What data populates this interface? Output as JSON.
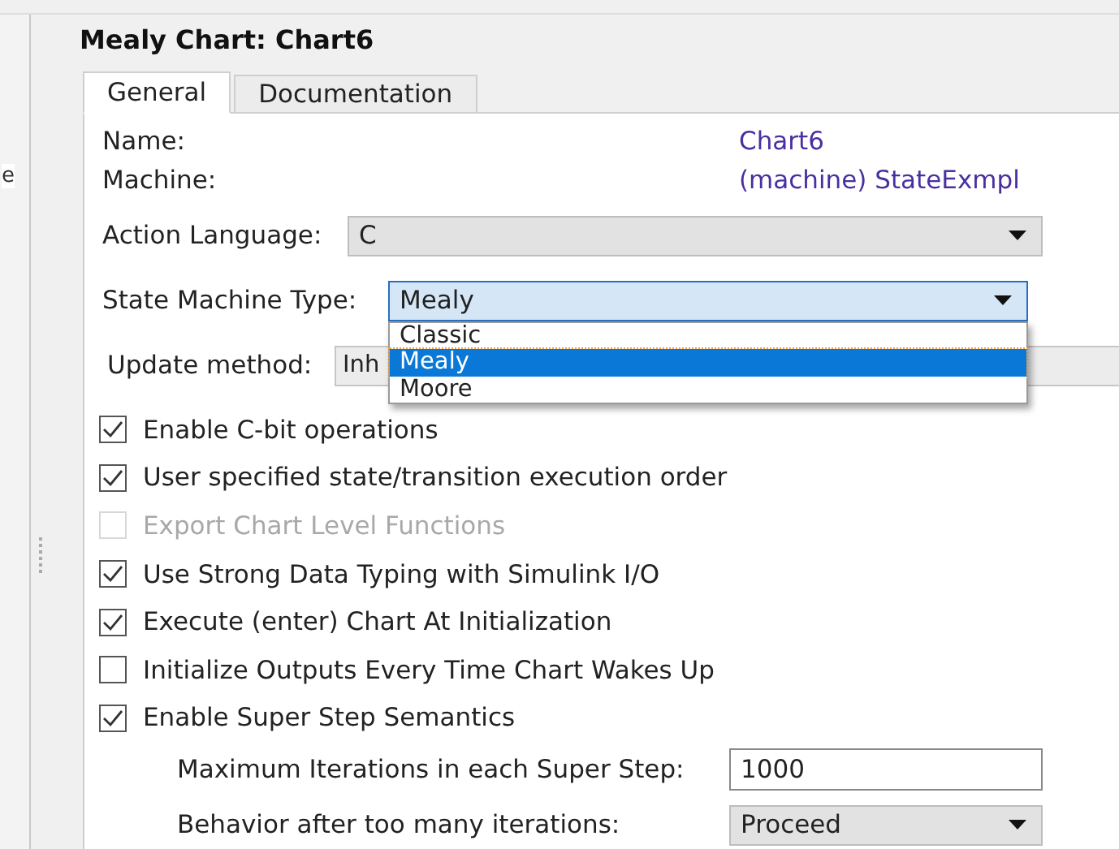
{
  "title": "Mealy Chart: Chart6",
  "left_pane": {
    "text": "e"
  },
  "tabs": [
    {
      "label": "General",
      "selected": true
    },
    {
      "label": "Documentation",
      "selected": false
    }
  ],
  "info": [
    {
      "label": "Name:",
      "value": "Chart6"
    },
    {
      "label": "Machine:",
      "value": "(machine) StateExmpl"
    }
  ],
  "action_language": {
    "label": "Action Language:",
    "value": "C"
  },
  "state_machine_type": {
    "label": "State Machine Type:",
    "value": "Mealy",
    "expanded": true,
    "options": [
      {
        "label": "Classic",
        "selected": false
      },
      {
        "label": "Mealy",
        "selected": true
      },
      {
        "label": "Moore",
        "selected": false
      }
    ]
  },
  "update_method": {
    "label": "Update method:",
    "value": "Inh"
  },
  "options": [
    {
      "label": "Enable C-bit operations",
      "checked": true,
      "disabled": false
    },
    {
      "label": "User specified state/transition execution order",
      "checked": true,
      "disabled": false
    },
    {
      "label": "Export Chart Level Functions",
      "checked": false,
      "disabled": true
    },
    {
      "label": "Use Strong Data Typing with Simulink I/O",
      "checked": true,
      "disabled": false
    },
    {
      "label": "Execute (enter) Chart At Initialization",
      "checked": true,
      "disabled": false
    },
    {
      "label": "Initialize Outputs Every Time Chart Wakes Up",
      "checked": false,
      "disabled": false
    },
    {
      "label": "Enable Super Step Semantics",
      "checked": true,
      "disabled": false
    }
  ],
  "super_step": [
    {
      "label": "Maximum Iterations in each Super Step:",
      "kind": "input",
      "value": "1000"
    },
    {
      "label": "Behavior after too many iterations:",
      "kind": "dropdown",
      "value": "Proceed"
    }
  ]
}
